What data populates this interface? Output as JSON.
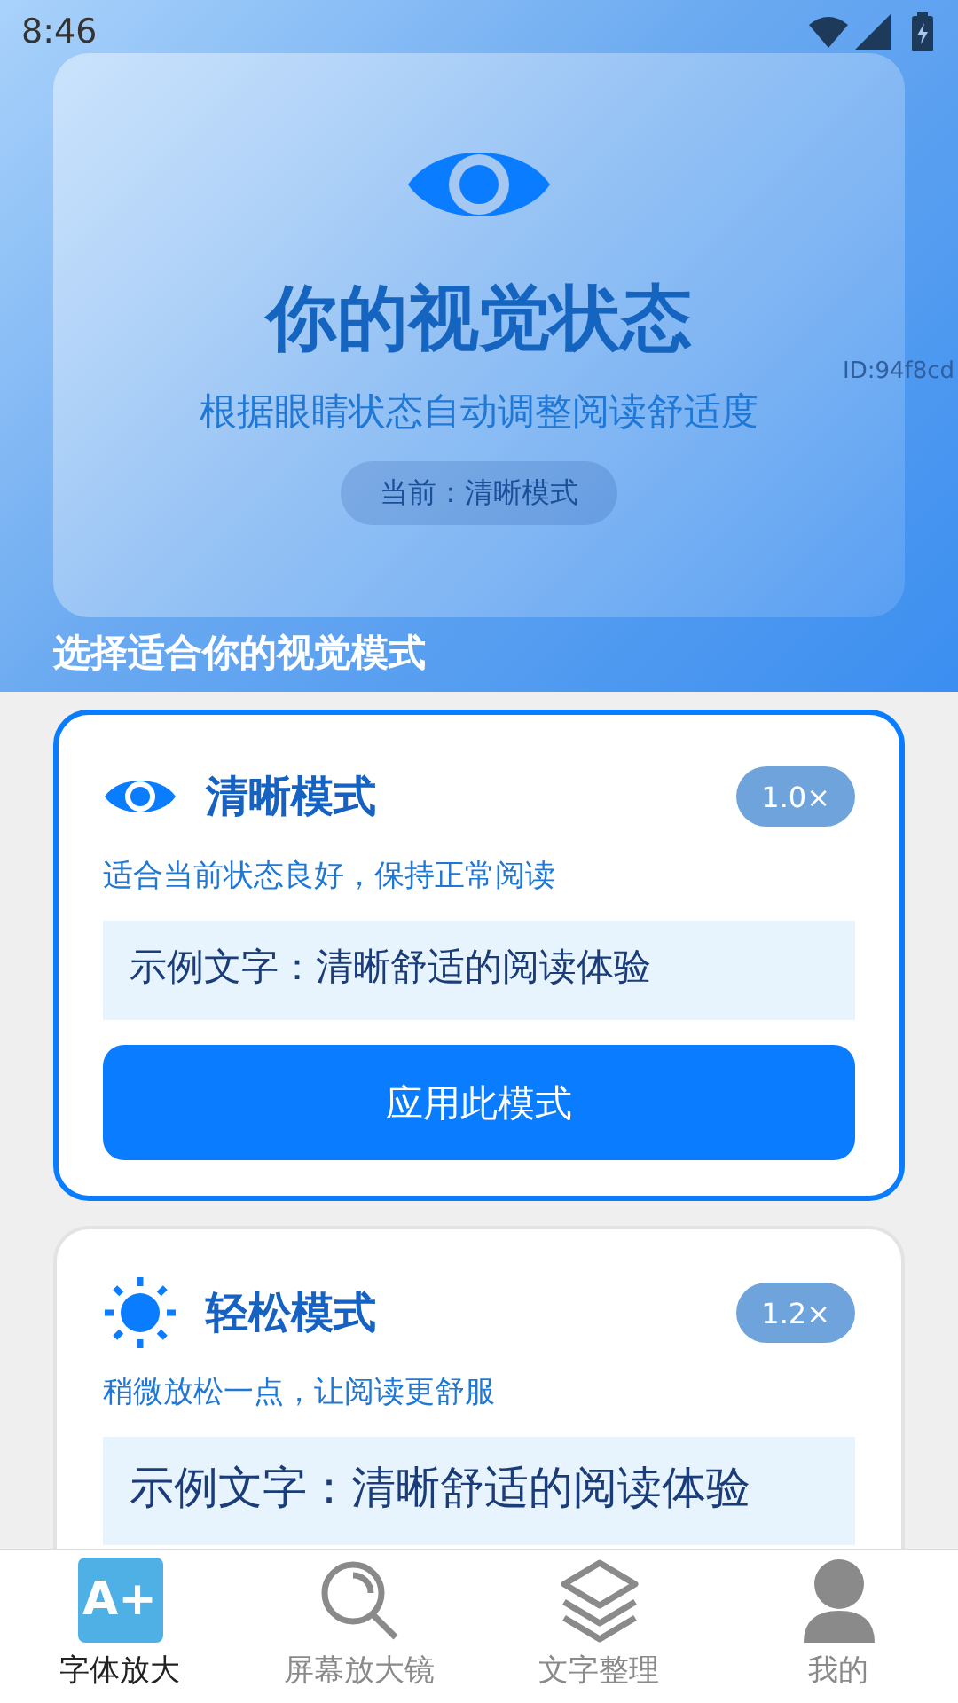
{
  "status_bar": {
    "time": "8:46"
  },
  "header": {
    "title": "你的视觉状态",
    "subtitle": "根据眼睛状态自动调整阅读舒适度",
    "current": "当前：清晰模式",
    "id_text": "ID:94f8cd"
  },
  "section_title": "选择适合你的视觉模式",
  "modes": [
    {
      "kind": "eye",
      "title": "清晰模式",
      "scale": "1.0×",
      "description": "适合当前状态良好，保持正常阅读",
      "sample": "示例文字：清晰舒适的阅读体验",
      "button": "应用此模式",
      "selected": true
    },
    {
      "kind": "sun",
      "title": "轻松模式",
      "scale": "1.2×",
      "description": "稍微放松一点，让阅读更舒服",
      "sample": "示例文字：清晰舒适的阅读体验",
      "selected": false
    }
  ],
  "nav": [
    {
      "kind": "font",
      "icon_text": "A+",
      "label": "字体放大",
      "selected": true
    },
    {
      "kind": "magnifier",
      "label": "屏幕放大镜",
      "selected": false
    },
    {
      "kind": "layers",
      "label": "文字整理",
      "selected": false
    },
    {
      "kind": "profile",
      "label": "我的",
      "selected": false
    }
  ]
}
